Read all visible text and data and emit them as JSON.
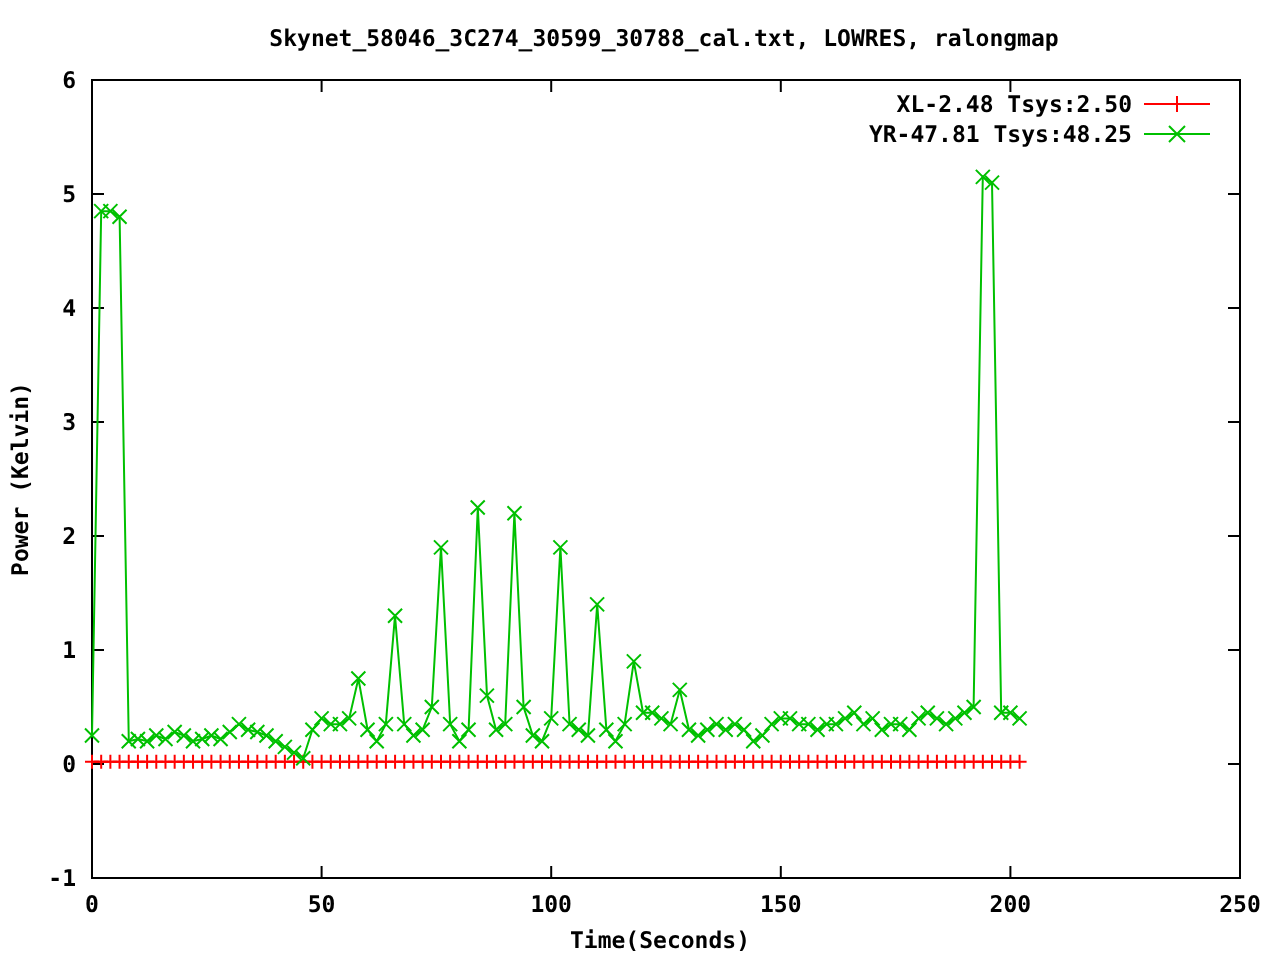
{
  "chart": {
    "chart_data": {
      "type": "line",
      "title": "Skynet_58046_3C274_30599_30788_cal.txt, LOWRES, ralongmap",
      "xlabel": "Time(Seconds)",
      "ylabel": "Power (Kelvin)",
      "x": [
        0,
        2,
        4,
        6,
        8,
        10,
        12,
        14,
        16,
        18,
        20,
        22,
        24,
        26,
        28,
        30,
        32,
        34,
        36,
        38,
        40,
        42,
        44,
        46,
        48,
        50,
        52,
        54,
        56,
        58,
        60,
        62,
        64,
        66,
        68,
        70,
        72,
        74,
        76,
        78,
        80,
        82,
        84,
        86,
        88,
        90,
        92,
        94,
        96,
        98,
        100,
        102,
        104,
        106,
        108,
        110,
        112,
        114,
        116,
        118,
        120,
        122,
        124,
        126,
        128,
        130,
        132,
        134,
        136,
        138,
        140,
        142,
        144,
        146,
        148,
        150,
        152,
        154,
        156,
        158,
        160,
        162,
        164,
        166,
        168,
        170,
        172,
        174,
        176,
        178,
        180,
        182,
        184,
        186,
        188,
        190,
        192,
        194,
        196,
        198,
        200,
        202
      ],
      "series": [
        {
          "name": "XL-2.48 Tsys:2.50",
          "color": "#ff0000",
          "marker": "plus",
          "values": [
            0.02,
            0.02,
            0.02,
            0.02,
            0.02,
            0.02,
            0.02,
            0.02,
            0.02,
            0.02,
            0.02,
            0.02,
            0.02,
            0.02,
            0.02,
            0.02,
            0.02,
            0.02,
            0.02,
            0.02,
            0.02,
            0.02,
            0.02,
            0.02,
            0.02,
            0.02,
            0.02,
            0.02,
            0.02,
            0.02,
            0.02,
            0.02,
            0.02,
            0.02,
            0.02,
            0.02,
            0.02,
            0.02,
            0.02,
            0.02,
            0.02,
            0.02,
            0.02,
            0.02,
            0.02,
            0.02,
            0.02,
            0.02,
            0.02,
            0.02,
            0.02,
            0.02,
            0.02,
            0.02,
            0.02,
            0.02,
            0.02,
            0.02,
            0.02,
            0.02,
            0.02,
            0.02,
            0.02,
            0.02,
            0.02,
            0.02,
            0.02,
            0.02,
            0.02,
            0.02,
            0.02,
            0.02,
            0.02,
            0.02,
            0.02,
            0.02,
            0.02,
            0.02,
            0.02,
            0.02,
            0.02,
            0.02,
            0.02,
            0.02,
            0.02,
            0.02,
            0.02,
            0.02,
            0.02,
            0.02,
            0.02,
            0.02,
            0.02,
            0.02,
            0.02,
            0.02,
            0.02,
            0.02,
            0.02,
            0.02,
            0.02,
            0.02
          ]
        },
        {
          "name": "YR-47.81 Tsys:48.25",
          "color": "#00c000",
          "marker": "cross",
          "values": [
            0.25,
            4.85,
            4.85,
            4.8,
            0.2,
            0.22,
            0.2,
            0.25,
            0.22,
            0.28,
            0.25,
            0.2,
            0.22,
            0.25,
            0.22,
            0.28,
            0.35,
            0.3,
            0.28,
            0.25,
            0.2,
            0.15,
            0.1,
            0.05,
            0.3,
            0.4,
            0.35,
            0.35,
            0.4,
            0.75,
            0.3,
            0.2,
            0.35,
            1.3,
            0.35,
            0.25,
            0.3,
            0.5,
            1.9,
            0.35,
            0.2,
            0.3,
            2.25,
            0.6,
            0.3,
            0.35,
            2.2,
            0.5,
            0.25,
            0.2,
            0.4,
            1.9,
            0.35,
            0.3,
            0.25,
            1.4,
            0.3,
            0.2,
            0.35,
            0.9,
            0.45,
            0.45,
            0.4,
            0.35,
            0.65,
            0.3,
            0.25,
            0.3,
            0.35,
            0.3,
            0.35,
            0.3,
            0.2,
            0.25,
            0.35,
            0.4,
            0.4,
            0.35,
            0.35,
            0.3,
            0.35,
            0.35,
            0.4,
            0.45,
            0.35,
            0.4,
            0.3,
            0.35,
            0.35,
            0.3,
            0.4,
            0.45,
            0.4,
            0.35,
            0.4,
            0.45,
            0.5,
            5.15,
            5.1,
            0.45,
            0.45,
            0.4
          ]
        }
      ],
      "legend": "top-right",
      "xlim": [
        0,
        250
      ],
      "ylim": [
        -1,
        6
      ],
      "xticks": [
        0,
        50,
        100,
        150,
        200,
        250
      ],
      "yticks": [
        -1,
        0,
        1,
        2,
        3,
        4,
        5,
        6
      ]
    }
  }
}
